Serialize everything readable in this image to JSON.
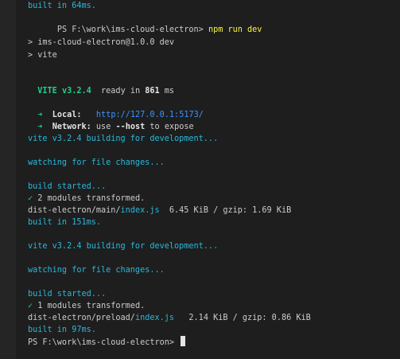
{
  "terminal": {
    "l1": "built in 64ms.",
    "l2_prompt": "PS F:\\work\\ims-cloud-electron>",
    "l2_cmd": "npm run dev",
    "l3": "> ims-cloud-electron@1.0.0 dev",
    "l4": "> vite",
    "vite_name": "VITE v3.2.4",
    "vite_ready_pre": "ready in ",
    "vite_ready_ms": "861",
    "vite_ready_unit": " ms",
    "local_arrow": "➜",
    "local_label": "Local:",
    "local_url": "http://127.0.0.1:5173/",
    "network_arrow": "➜",
    "network_label": "Network:",
    "network_text_pre": "use ",
    "network_flag": "--host",
    "network_text_post": " to expose",
    "building1": "vite v3.2.4 building for development...",
    "watching1": "watching for file changes...",
    "build_started1": "build started...",
    "check1": "✓",
    "transformed1": "2 modules transformed.",
    "file1_dir": "dist-electron/main/",
    "file1_name": "index.js",
    "file1_size": "  6.45 KiB / gzip: 1.69 KiB",
    "built1": "built in 151ms.",
    "building2": "vite v3.2.4 building for development...",
    "watching2": "watching for file changes...",
    "build_started2": "build started...",
    "check2": "✓",
    "transformed2": "1 modules transformed.",
    "file2_dir": "dist-electron/preload/",
    "file2_name": "index.js",
    "file2_size": "   2.14 KiB / gzip: 0.86 KiB",
    "built2": "built in 97ms.",
    "last_prompt": "PS F:\\work\\ims-cloud-electron>"
  },
  "colors": {
    "background": "#1e1e1e",
    "cyan": "#29b8db",
    "green": "#23d18b",
    "yellow": "#f5f543",
    "link": "#3794ff",
    "text": "#cccccc"
  }
}
